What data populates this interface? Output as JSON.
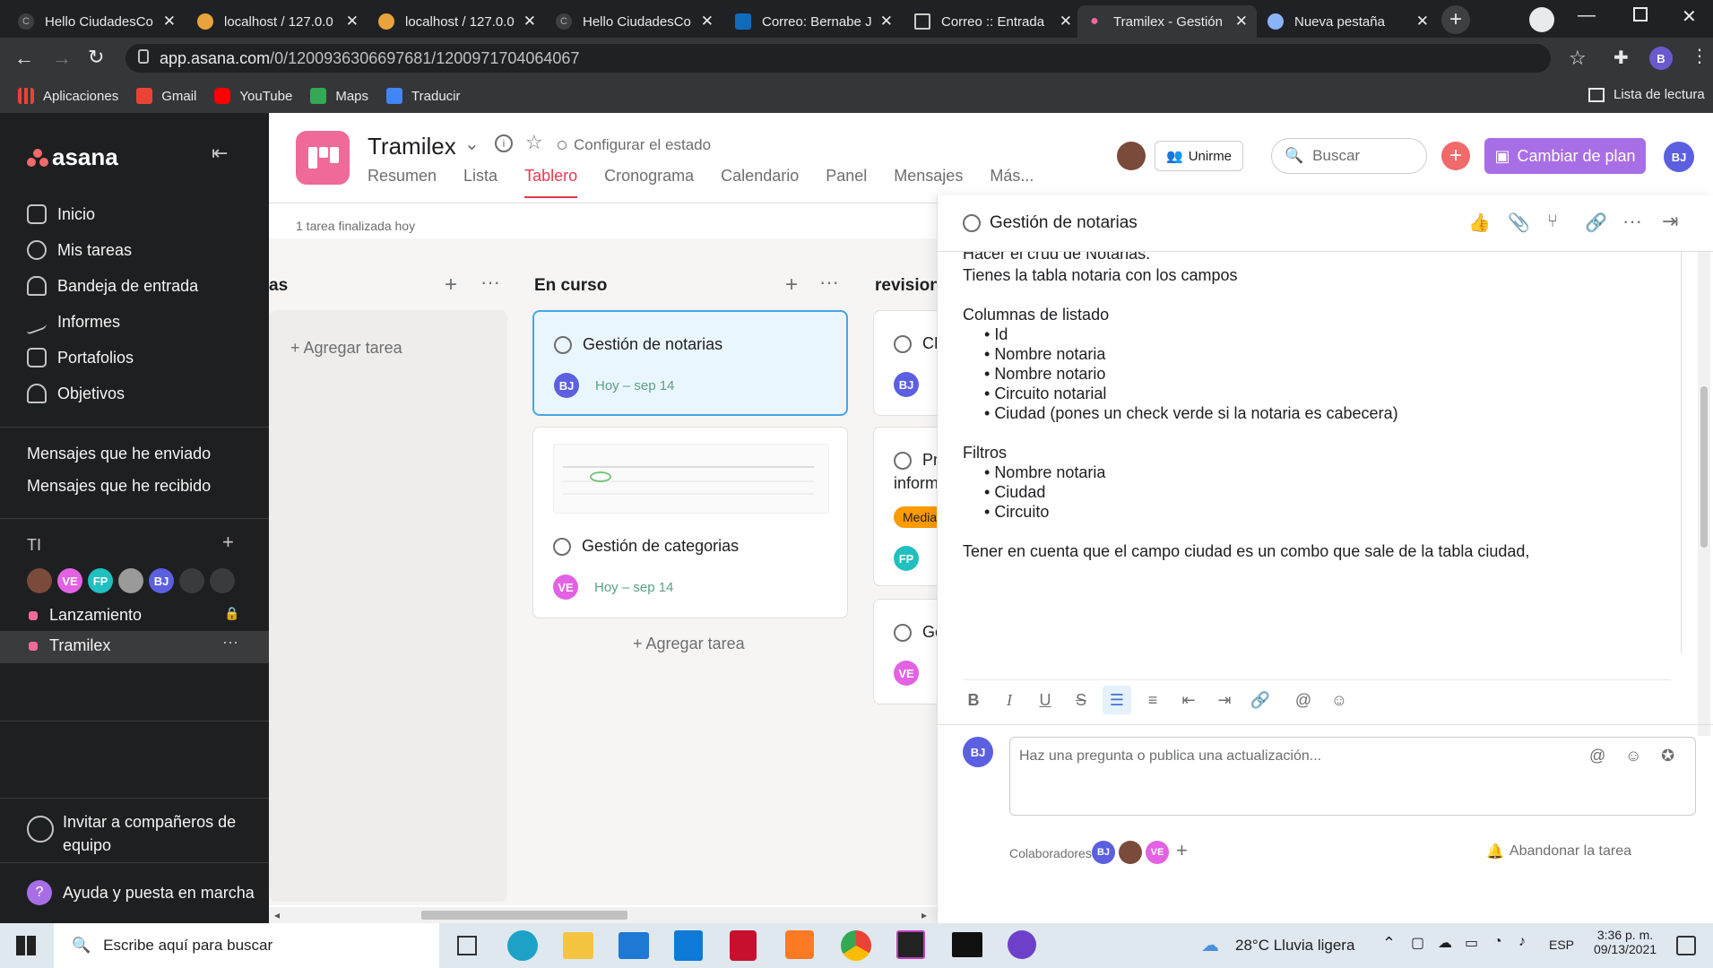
{
  "browser": {
    "tabs": [
      {
        "title": "Hello CiudadesCo",
        "active": false
      },
      {
        "title": "localhost / 127.0.0",
        "active": false
      },
      {
        "title": "localhost / 127.0.0",
        "active": false
      },
      {
        "title": "Hello CiudadesCo",
        "active": false
      },
      {
        "title": "Correo: Bernabe J",
        "active": false
      },
      {
        "title": "Correo :: Entrada",
        "active": false
      },
      {
        "title": "Tramilex - Gestión",
        "active": true
      },
      {
        "title": "Nueva pestaña",
        "active": false
      }
    ],
    "url_host": "app.asana.com",
    "url_path": "/0/1200936306697681/1200971704064067",
    "profile_initial": "B",
    "bookmarks": [
      "Aplicaciones",
      "Gmail",
      "YouTube",
      "Maps",
      "Traducir"
    ],
    "reading_list": "Lista de lectura"
  },
  "sidebar": {
    "logo": "asana",
    "nav": [
      "Inicio",
      "Mis tareas",
      "Bandeja de entrada",
      "Informes",
      "Portafolios",
      "Objetivos"
    ],
    "messages": [
      "Mensajes que he enviado",
      "Mensajes que he recibido"
    ],
    "team": "TI",
    "team_members": [
      "VE",
      "FP",
      "BJ"
    ],
    "projects": [
      "Lanzamiento",
      "Tramilex"
    ],
    "invite": "Invitar a compañeros de equipo",
    "help": "Ayuda y puesta en marcha"
  },
  "header": {
    "project_title": "Tramilex",
    "set_status": "Configurar el estado",
    "tabs": [
      "Resumen",
      "Lista",
      "Tablero",
      "Cronograma",
      "Calendario",
      "Panel",
      "Mensajes",
      "Más..."
    ],
    "active_tab": "Tablero",
    "join": "Unirme",
    "search_placeholder": "Buscar",
    "upgrade": "Cambiar de plan",
    "user_initials": "BJ",
    "finished_today": "1 tarea finalizada hoy"
  },
  "board": {
    "col1_header_partial": "as",
    "col1_add_task": "Agregar tarea",
    "col2_header": "En curso",
    "col2_cards": [
      {
        "title": "Gestión de notarias",
        "assignee": "BJ",
        "due": "Hoy – sep 14"
      },
      {
        "title": "Gestión de categorias",
        "assignee": "VE",
        "due": "Hoy – sep 14"
      }
    ],
    "col2_add_task": "Agregar tarea",
    "col3_header": "revision",
    "col3_cards": [
      {
        "title": "CF",
        "assignee": "BJ"
      },
      {
        "title": "Pr",
        "subtitle": "inform",
        "tag": "Media",
        "assignee": "FP"
      },
      {
        "title": "Ge",
        "assignee": "VE"
      }
    ]
  },
  "task": {
    "title": "Gestión de notarias",
    "description_line1": "Hacer el crud de Notarias.",
    "description_line2": "Tienes la tabla notaria con los campos",
    "columns_heading": "Columnas de listado",
    "columns": [
      "Id",
      "Nombre notaria",
      "Nombre notario",
      "Circuito notarial",
      "Ciudad (pones un check verde si la notaria es cabecera)"
    ],
    "filters_heading": "Filtros",
    "filters": [
      "Nombre notaria",
      "Ciudad",
      "Circuito"
    ],
    "note": "Tener en cuenta que el campo ciudad es un combo que sale de la tabla ciudad,",
    "comment_placeholder": "Haz una pregunta o publica una actualización...",
    "collaborators_label": "Colaboradores",
    "collaborators": [
      "BJ",
      "VE"
    ],
    "leave_task": "Abandonar la tarea",
    "commenter_initials": "BJ"
  },
  "taskbar": {
    "search_placeholder": "Escribe aquí para buscar",
    "weather": "28°C  Lluvia ligera",
    "language": "ESP",
    "time": "3:36 p. m.",
    "date": "09/13/2021"
  },
  "colors": {
    "sidebar_bg": "#1e1f21",
    "accent_pink": "#f06a99",
    "upgrade_purple": "#a86ee6",
    "due_green": "#58a182",
    "card_selected_bg": "#eaf6fe",
    "card_selected_border": "#4ba4e4"
  }
}
